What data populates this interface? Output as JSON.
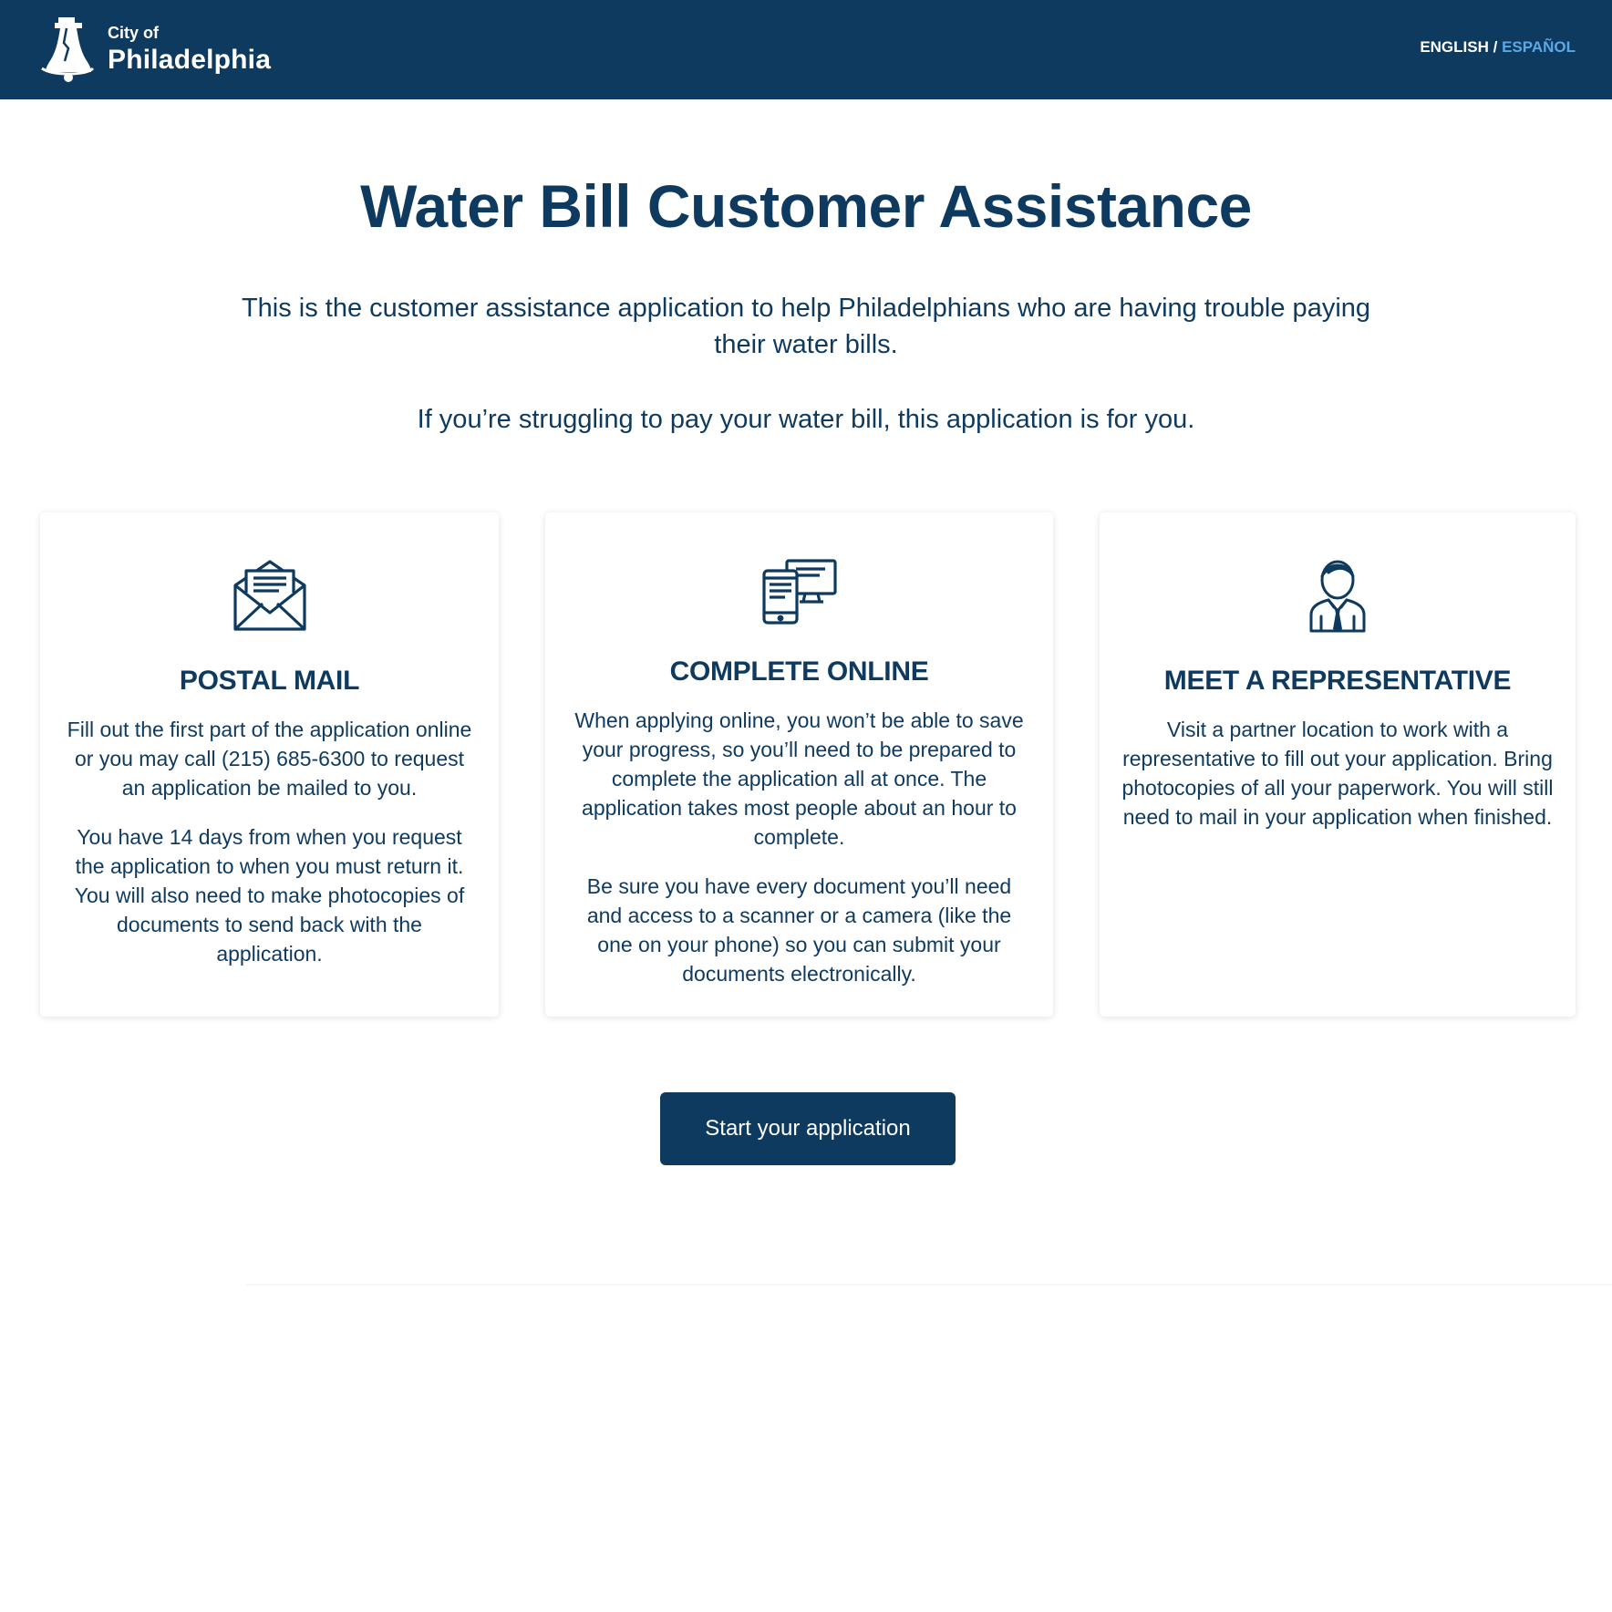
{
  "header": {
    "logo": {
      "small": "City of",
      "big": "Philadelphia"
    },
    "lang_english": "ENGLISH",
    "lang_separator": "/",
    "lang_spanish": "ESPAÑOL"
  },
  "main": {
    "title": "Water Bill Customer Assistance",
    "intro": "This is the customer assistance application to help Philadelphians who are having trouble paying their water bills.",
    "intro2": "If you’re struggling to pay your water bill, this application is for you."
  },
  "cards": [
    {
      "icon": "envelope-icon",
      "title": "POSTAL MAIL",
      "paragraphs": [
        "Fill out the first part of the application online or you may call (215) 685-6300 to request an application be mailed to you.",
        "You have 14 days from when you request the application to when you must return it. You will also need to make photocopies of documents to send back with the application."
      ]
    },
    {
      "icon": "devices-icon",
      "title": "COMPLETE ONLINE",
      "paragraphs": [
        "When applying online, you won’t be able to save your progress, so you’ll need to be prepared to complete the application all at once. The application takes most people about an hour to complete.",
        "Be sure you have every document you’ll need and access to a scanner or a camera (like the one on your phone) so you can submit your documents electronically."
      ]
    },
    {
      "icon": "representative-icon",
      "title": "MEET A REPRESENTATIVE",
      "paragraphs": [
        "Visit a partner location to work with a representative to fill out your application. Bring photocopies of all your paperwork. You will still need to mail in your application when finished."
      ]
    }
  ],
  "cta": {
    "start_label": "Start your application"
  },
  "colors": {
    "primary": "#0f3a5f",
    "accent": "#5aa9e6",
    "background": "#ffffff"
  }
}
